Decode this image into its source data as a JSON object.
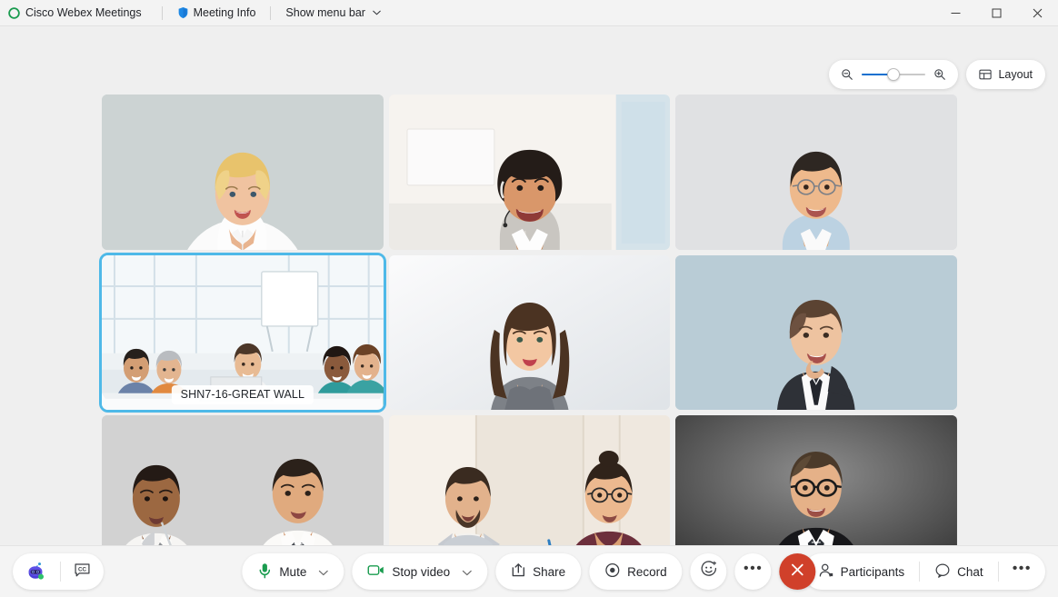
{
  "window": {
    "app_title": "Cisco Webex Meetings",
    "logo_icon": "webex-logo-icon",
    "menu": {
      "meeting_info_label": "Meeting Info",
      "meeting_info_icon": "shield-icon",
      "show_menu_bar_label": "Show menu bar",
      "show_menu_bar_icon": "chevron-down-icon"
    },
    "controls": {
      "minimize_icon": "minimize-icon",
      "maximize_icon": "maximize-icon",
      "close_icon": "close-icon"
    }
  },
  "top_controls": {
    "zoom_out_icon": "zoom-out-icon",
    "zoom_in_icon": "zoom-in-icon",
    "zoom_slider_value": 50,
    "layout_label": "Layout",
    "layout_icon": "grid-layout-icon"
  },
  "video_grid": {
    "columns": 3,
    "rows": 3,
    "active_speaker_border_color": "#4eb9e8",
    "tiles": [
      {
        "id": "tile-1",
        "name": "",
        "background": "#ccd3d3",
        "active": false,
        "scene": "woman-blonde-white-shirt"
      },
      {
        "id": "tile-2",
        "name": "",
        "background": "#f0eeeb",
        "active": false,
        "scene": "man-beard-headset-grey-suit"
      },
      {
        "id": "tile-3",
        "name": "",
        "background": "#dcdddf",
        "active": false,
        "scene": "man-glasses-light-blue-shirt"
      },
      {
        "id": "tile-4",
        "name": "SHN7-16-GREAT WALL",
        "background": "#e9eef1",
        "active": true,
        "scene": "conference-room-group"
      },
      {
        "id": "tile-5",
        "name": "",
        "background": "#f2f3f5",
        "active": false,
        "scene": "woman-brunette-grey-top"
      },
      {
        "id": "tile-6",
        "name": "",
        "background": "#b9ccd6",
        "active": false,
        "scene": "man-hand-on-chin-dark-suit"
      },
      {
        "id": "tile-7",
        "name": "",
        "background": "#d2d2d2",
        "active": false,
        "scene": "two-men-white-shirts"
      },
      {
        "id": "tile-8",
        "name": "",
        "background": "#efe9e2",
        "active": false,
        "scene": "man-and-woman-with-laptop"
      },
      {
        "id": "tile-9",
        "name": "",
        "background": "#555555",
        "active": false,
        "scene": "man-glasses-black-suit-dark-bg"
      }
    ]
  },
  "toolbar": {
    "assistant_icon": "webex-assistant-robot-icon",
    "captions_icon": "closed-captions-icon",
    "mute_label": "Mute",
    "mute_icon": "microphone-icon",
    "mute_icon_color": "#1a9c4f",
    "mute_caret_icon": "chevron-down-icon",
    "video_label": "Stop video",
    "video_icon": "video-camera-icon",
    "video_icon_color": "#1a9c4f",
    "video_caret_icon": "chevron-down-icon",
    "share_label": "Share",
    "share_icon": "share-upload-icon",
    "record_label": "Record",
    "record_icon": "record-circle-icon",
    "reactions_icon": "smiley-reaction-icon",
    "more_options_icon": "more-options-icon",
    "more_options_label": "•••",
    "end_meeting_icon": "close-icon",
    "end_meeting_color": "#d0402a",
    "participants_label": "Participants",
    "participants_icon": "participants-person-icon",
    "chat_label": "Chat",
    "chat_icon": "chat-bubble-icon",
    "right_more_icon": "more-options-icon",
    "right_more_label": "•••"
  }
}
